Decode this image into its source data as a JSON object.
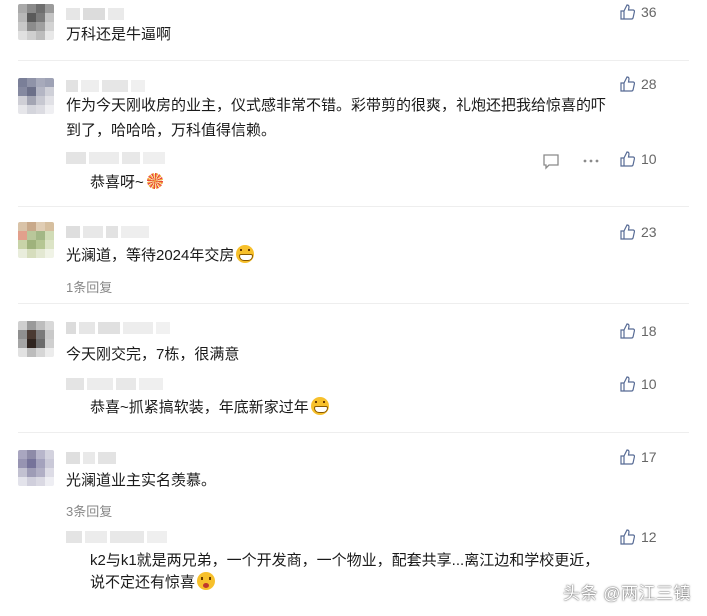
{
  "comments": [
    {
      "text": "万科还是牛逼啊",
      "likes": "36"
    },
    {
      "text_line1": "作为今天刚收房的业主，仪式感非常不错。彩带剪的很爽，礼炮还把我给惊喜的吓",
      "text_line2": "到了，哈哈哈，万科值得信赖。",
      "likes": "28",
      "reply": {
        "text": "恭喜呀~",
        "emoji": "firework-emoji",
        "likes": "10"
      }
    },
    {
      "text": "光澜道，等待2024年交房",
      "emoji": "grinning-emoji",
      "likes": "23",
      "replies_link": "1条回复"
    },
    {
      "text": "今天刚交完，7栋，很满意",
      "likes": "18",
      "reply": {
        "text": "恭喜~抓紧搞软装，年底新家过年",
        "emoji": "grinning-emoji",
        "likes": "10"
      }
    },
    {
      "text": "光澜道业主实名羡慕。",
      "likes": "17",
      "replies_link": "3条回复",
      "reply": {
        "text_line1": "k2与k1就是两兄弟，一个开发商，一个物业，配套共享...离江边和学校更近，",
        "text_line2": "说不定还有惊喜",
        "emoji": "winking-emoji",
        "likes": "12"
      }
    }
  ],
  "watermark": "头条 @两江三镇",
  "icons": {
    "like": "thumbs-up-icon",
    "comment": "comment-icon",
    "more": "more-icon"
  },
  "colors": {
    "like_icon": "#576b95",
    "count": "#666666",
    "replies_link": "#888888"
  }
}
